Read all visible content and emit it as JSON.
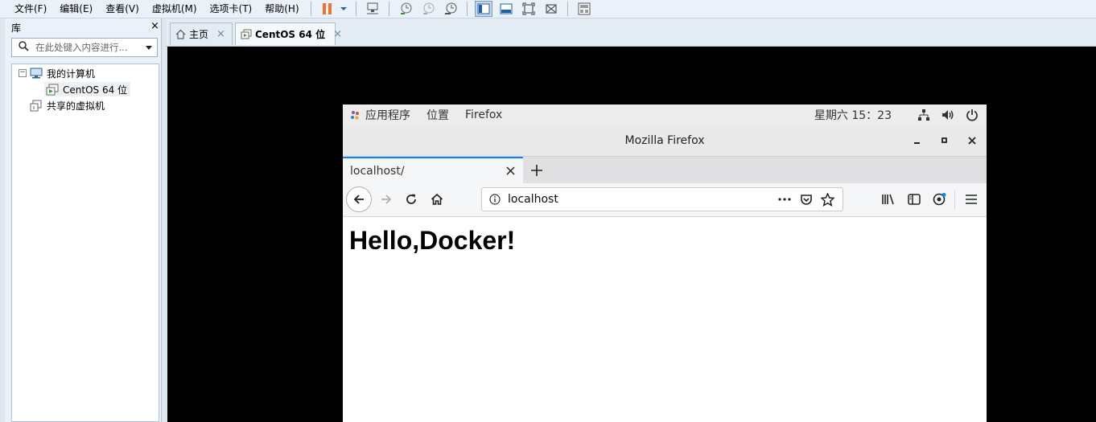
{
  "menu": [
    "文件(F)",
    "编辑(E)",
    "查看(V)",
    "虚拟机(M)",
    "选项卡(T)",
    "帮助(H)"
  ],
  "toolbar": {
    "icons": [
      "pause-icon",
      "dropdown-icon",
      "send-ctrl-alt-del-icon",
      "snapshot-icon",
      "revert-snapshot-icon",
      "snapshot-manager-icon",
      "library-view-icon",
      "console-view-icon",
      "fullscreen-icon",
      "unity-icon",
      "thumbnail-icon"
    ],
    "accent": "#e8762c"
  },
  "library": {
    "title": "库",
    "close": "×",
    "search_placeholder": "在此处键入内容进行...",
    "tree": {
      "root": "我的计算机",
      "root_toggle": "−",
      "vm": "CentOS 64 位",
      "shared": "共享的虚拟机"
    }
  },
  "vm_tabs": [
    {
      "label": "主页",
      "close": "×",
      "icon": "home-icon"
    },
    {
      "label": "CentOS 64 位",
      "close": "×",
      "icon": "vm-icon"
    }
  ],
  "gnome": {
    "apps": "应用程序",
    "places": "位置",
    "firefox": "Firefox",
    "clock": "星期六 15：23"
  },
  "firefox": {
    "window_title": "Mozilla Firefox",
    "tab_title": "localhost/",
    "url": "localhost",
    "page_heading": "Hello,Docker!",
    "accent": "#0a84ff"
  }
}
